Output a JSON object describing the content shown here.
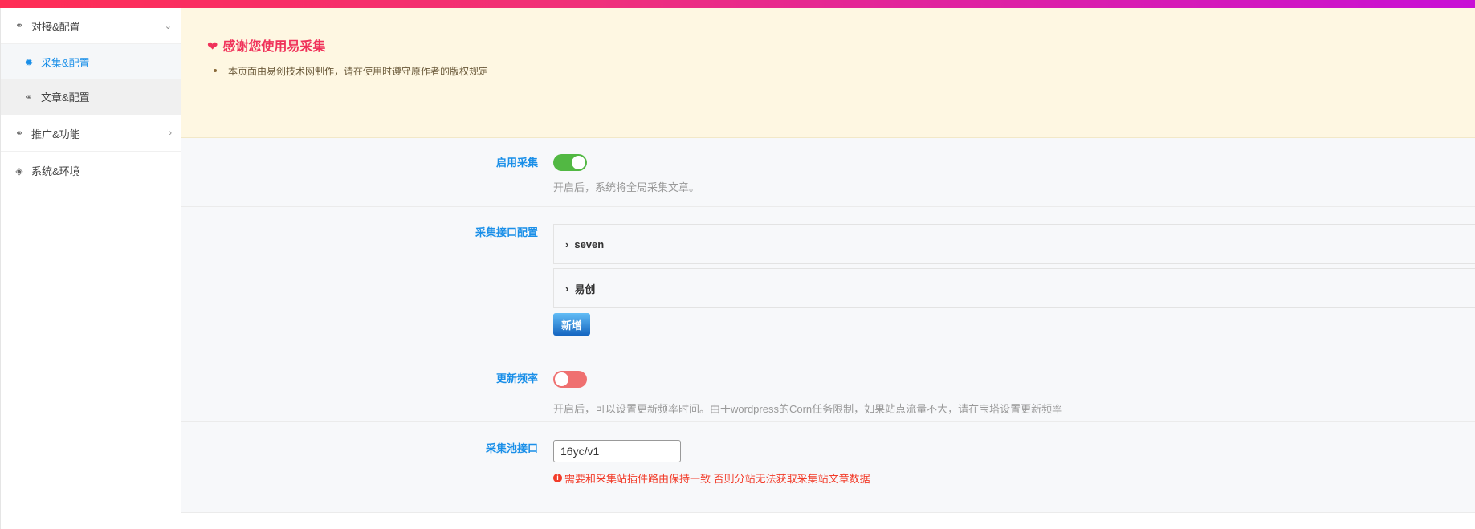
{
  "colors": {
    "accent": "#1a8fe8",
    "toggle_on": "#52b843",
    "toggle_off": "#ef7070",
    "error": "#f23c2a",
    "notice_title": "#f0325a"
  },
  "sidebar": {
    "items": [
      {
        "label": "对接&配置",
        "icon": "link-icon",
        "arrow": "⌄",
        "expanded": true
      },
      {
        "label": "采集&配置",
        "icon": "gear-icon",
        "active": true
      },
      {
        "label": "文章&配置",
        "icon": "link-icon"
      },
      {
        "label": "推广&功能",
        "icon": "link-icon",
        "arrow": "›"
      },
      {
        "label": "系统&环境",
        "icon": "fox-icon"
      }
    ]
  },
  "notice": {
    "title": "感谢您使用易采集",
    "items": [
      "本页面由易创技术网制作，请在使用时遵守原作者的版权规定"
    ]
  },
  "settings": {
    "enable": {
      "label": "启用采集",
      "on": true,
      "desc": "开启后，系统将全局采集文章。"
    },
    "api": {
      "label": "采集接口配置",
      "entries": [
        "seven",
        "易创"
      ],
      "add_label": "新增"
    },
    "frequency": {
      "label": "更新频率",
      "on": false,
      "desc": "开启后，可以设置更新频率时间。由于wordpress的Corn任务限制，如果站点流量不大，请在宝塔设置更新频率"
    },
    "pool": {
      "label": "采集池接口",
      "value": "16yc/v1",
      "error": "需要和采集站插件路由保持一致 否则分站无法获取采集站文章数据"
    }
  }
}
